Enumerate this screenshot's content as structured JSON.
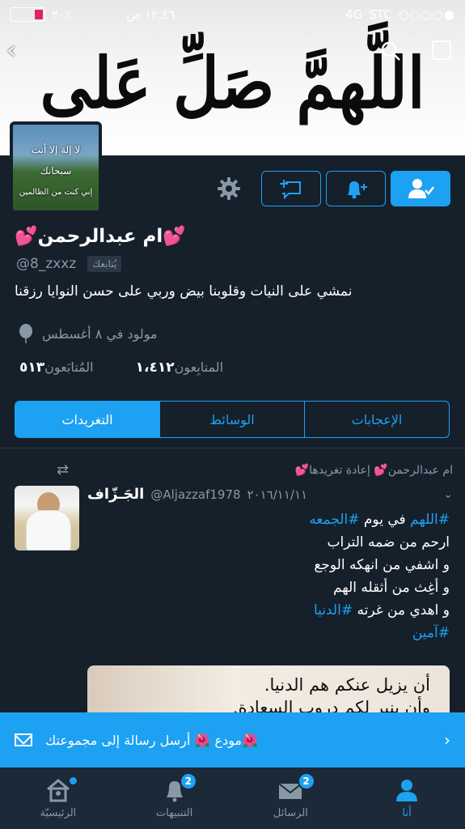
{
  "status_bar": {
    "battery": "٢٠٪",
    "time": "١٢:٤٦ ص",
    "carrier": "STC",
    "network": "4G",
    "signal_dots": "○○○○●"
  },
  "header": {
    "banner_text": "اللَّهمَّ صَلِّ عَلى مُحَمَّدٍ وآلِ مُحَمَّد"
  },
  "avatar": {
    "line1": "لا إلهَ إلا أنت",
    "line2": "سبحانك",
    "line3": "إني كنت من الظالمين"
  },
  "profile": {
    "name": "💕ام عبدالرحمن💕",
    "handle": "@8_zxxz",
    "follows_you": "يُتابعك",
    "bio": "نمشي على النيات وقلوبنا بيض وربي على حسن النوايا رزقنا",
    "birthday": "مولود في ٨ أغسطس",
    "following_label": "المُتابَعون",
    "following_count": "٥١٣",
    "followers_label": "المتابِعون",
    "followers_count": "١،٤١٢"
  },
  "tabs": [
    {
      "label": "التغريدات",
      "active": true
    },
    {
      "label": "الوسائط",
      "active": false
    },
    {
      "label": "الإعجابات",
      "active": false
    }
  ],
  "tweet": {
    "retweet_note": "💕ام عبدالرحمن💕 إعادة تغريدها",
    "author_name": "الجَـزّاف",
    "author_handle": "@Aljazzaf1978",
    "date": "٢٠١٦/١١/١١",
    "line1_prefix": "في يوم",
    "line1_tag1": "#الجمعه",
    "line1_tag2": "#اللهم",
    "line2": "ارحم من ضمه التراب",
    "line3": "و اشفي من انهكه الوجع",
    "line4": "و أغِث من أثقله الهم",
    "line5_prefix": "و اهدي من غرته",
    "line5_tag": "#الدنيا",
    "line6_tag": "#آمين",
    "media_line1": "أن يزيل عنكم هم الدنيا.",
    "media_line2": "وأن ينير لكم دروب السعادة."
  },
  "dm_banner": {
    "text": "🌺مودع 🌺 أرسل رسالة إلى مجموعتك"
  },
  "bottom_nav": [
    {
      "label": "الرئيسيّة",
      "badge": "",
      "dot": true
    },
    {
      "label": "التنبيهات",
      "badge": "2",
      "dot": false
    },
    {
      "label": "الرسائل",
      "badge": "2",
      "dot": false
    },
    {
      "label": "أنا",
      "badge": "",
      "dot": false
    }
  ],
  "colors": {
    "background": "#15202b",
    "accent": "#1da1f2",
    "secondary_text": "#8899a6"
  }
}
